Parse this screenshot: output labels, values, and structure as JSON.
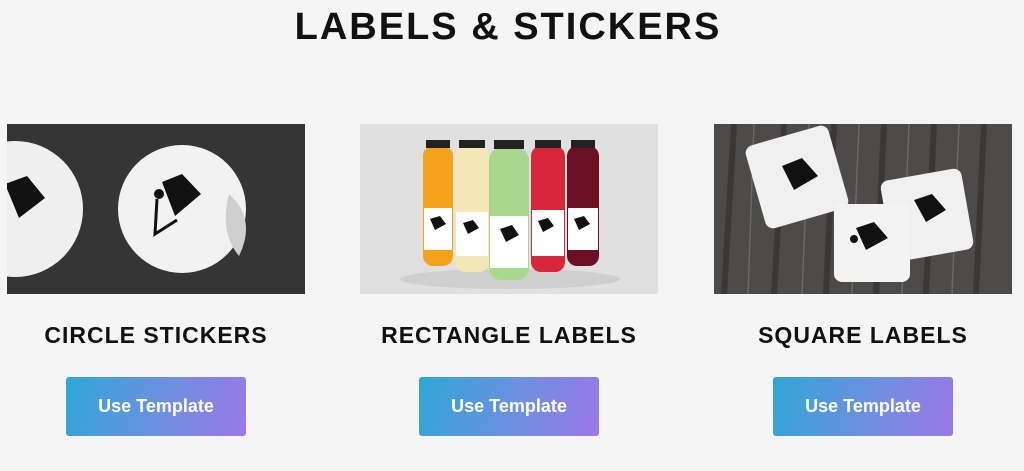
{
  "page": {
    "title": "LABELS & STICKERS"
  },
  "cards": [
    {
      "title": "CIRCLE STICKERS",
      "button_label": "Use Template",
      "image": "circle-stickers-photo"
    },
    {
      "title": "RECTANGLE LABELS",
      "button_label": "Use Template",
      "image": "bottle-labels-photo"
    },
    {
      "title": "SQUARE LABELS",
      "button_label": "Use Template",
      "image": "square-labels-photo"
    }
  ],
  "colors": {
    "background": "#f5f5f5",
    "button_gradient_start": "#2fa6d6",
    "button_gradient_end": "#9b78e8",
    "text": "#111111"
  }
}
